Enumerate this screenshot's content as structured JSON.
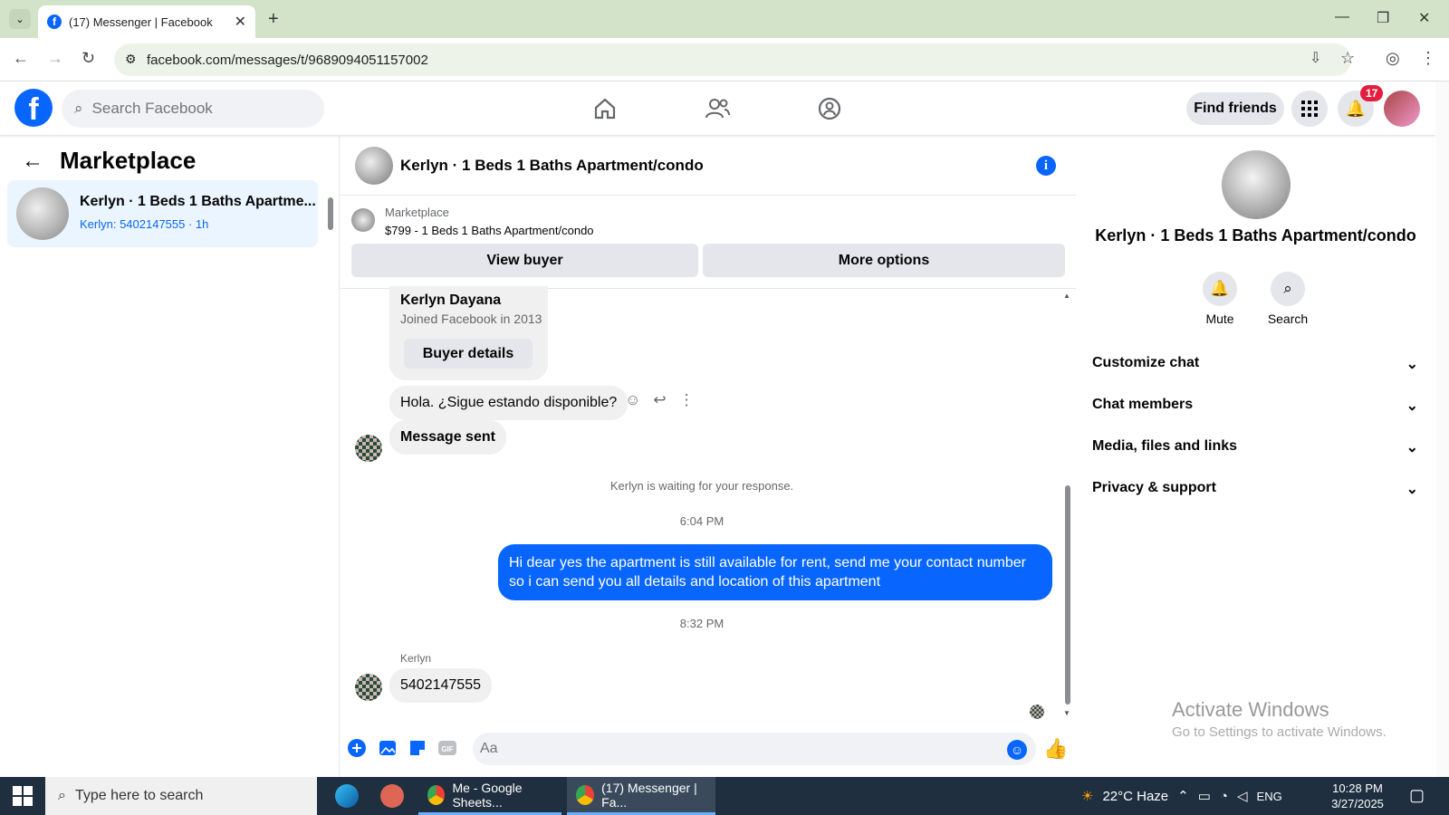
{
  "browser": {
    "tab_title": "(17) Messenger | Facebook",
    "url": "facebook.com/messages/t/9689094051157002"
  },
  "fb_header": {
    "search_placeholder": "Search Facebook",
    "find_friends": "Find friends",
    "notification_count": "17"
  },
  "left_panel": {
    "title": "Marketplace",
    "conversation": {
      "name": "Kerlyn · 1 Beds 1 Baths Apartme...",
      "subtitle": "Kerlyn: 5402147555 · 1h"
    }
  },
  "chat": {
    "header_title": "Kerlyn · 1 Beds 1 Baths Apartment/condo",
    "marketplace_label": "Marketplace",
    "listing": "$799 - 1 Beds 1 Baths Apartment/condo",
    "view_buyer": "View buyer",
    "more_options": "More options",
    "buyer_card": {
      "name": "Kerlyn Dayana",
      "joined": "Joined Facebook in 2013",
      "button": "Buyer details"
    },
    "message1": "Hola. ¿Sigue estando disponible?",
    "message_sent": "Message sent",
    "waiting": "Kerlyn is waiting for your response.",
    "time1": "6:04 PM",
    "my_message": "Hi dear yes the apartment is still available for rent, send me your contact number so i can send you all details and location of this apartment",
    "time2": "8:32 PM",
    "sender_label": "Kerlyn",
    "message2": "5402147555",
    "composer_placeholder": "Aa"
  },
  "right_panel": {
    "name": "Kerlyn · 1 Beds 1 Baths Apartment/condo",
    "mute": "Mute",
    "search": "Search",
    "sections": [
      "Customize chat",
      "Chat members",
      "Media, files and links",
      "Privacy & support"
    ]
  },
  "watermark": {
    "line1": "Activate Windows",
    "line2": "Go to Settings to activate Windows."
  },
  "taskbar": {
    "search_placeholder": "Type here to search",
    "app1": "Me - Google Sheets...",
    "app2": "(17) Messenger | Fa...",
    "weather": "22°C  Haze",
    "lang": "ENG",
    "time": "10:28 PM",
    "date": "3/27/2025"
  },
  "colors": {
    "brand_blue": "#0866ff",
    "tab_strip": "#d3e3c9",
    "taskbar": "#1f2f3f"
  }
}
